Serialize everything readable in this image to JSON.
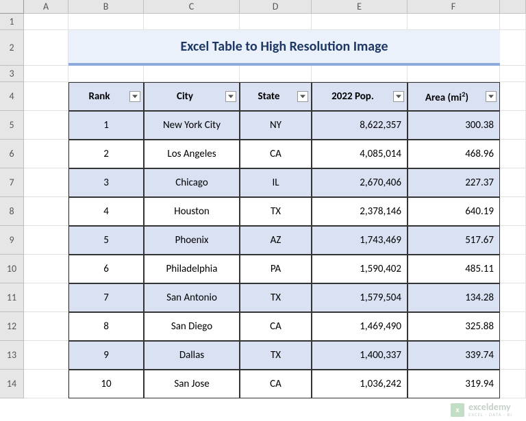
{
  "columns": [
    "A",
    "B",
    "C",
    "D",
    "E",
    "F"
  ],
  "rowNumbers": [
    "1",
    "2",
    "3",
    "4",
    "5",
    "6",
    "7",
    "8",
    "9",
    "10",
    "11",
    "12",
    "13",
    "14"
  ],
  "title": "Excel Table to High Resolution Image",
  "headers": {
    "rank": "Rank",
    "city": "City",
    "state": "State",
    "pop": "2022 Pop.",
    "area_prefix": "Area (mi",
    "area_suffix": ")"
  },
  "rows": [
    {
      "rank": "1",
      "city": "New York City",
      "state": "NY",
      "pop": "8,622,357",
      "area": "300.38"
    },
    {
      "rank": "2",
      "city": "Los Angeles",
      "state": "CA",
      "pop": "4,085,014",
      "area": "468.96"
    },
    {
      "rank": "3",
      "city": "Chicago",
      "state": "IL",
      "pop": "2,670,406",
      "area": "227.37"
    },
    {
      "rank": "4",
      "city": "Houston",
      "state": "TX",
      "pop": "2,378,146",
      "area": "640.19"
    },
    {
      "rank": "5",
      "city": "Phoenix",
      "state": "AZ",
      "pop": "1,743,469",
      "area": "517.67"
    },
    {
      "rank": "6",
      "city": "Philadelphia",
      "state": "PA",
      "pop": "1,590,402",
      "area": "485.11"
    },
    {
      "rank": "7",
      "city": "San Antonio",
      "state": "TX",
      "pop": "1,579,504",
      "area": "134.28"
    },
    {
      "rank": "8",
      "city": "San Diego",
      "state": "CA",
      "pop": "1,469,490",
      "area": "325.88"
    },
    {
      "rank": "9",
      "city": "Dallas",
      "state": "TX",
      "pop": "1,400,337",
      "area": "339.74"
    },
    {
      "rank": "10",
      "city": "San Jose",
      "state": "CA",
      "pop": "1,036,242",
      "area": "319.94"
    }
  ],
  "watermark": {
    "main": "exceldemy",
    "sub": "EXCEL · DATA · BI"
  }
}
